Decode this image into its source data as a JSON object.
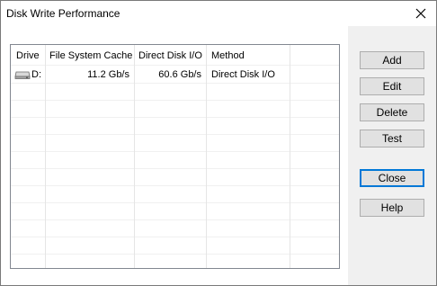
{
  "window": {
    "title": "Disk Write Performance"
  },
  "table": {
    "columns": [
      "Drive",
      "File System Cache",
      "Direct Disk I/O",
      "Method"
    ],
    "rows": [
      {
        "drive": "D:",
        "file_system_cache": "11.2 Gb/s",
        "direct_disk_io": "60.6 Gb/s",
        "method": "Direct Disk I/O"
      }
    ]
  },
  "buttons": {
    "add": "Add",
    "edit": "Edit",
    "delete": "Delete",
    "test": "Test",
    "close": "Close",
    "help": "Help"
  },
  "icons": {
    "close": "close-icon",
    "drive": "drive-icon"
  }
}
